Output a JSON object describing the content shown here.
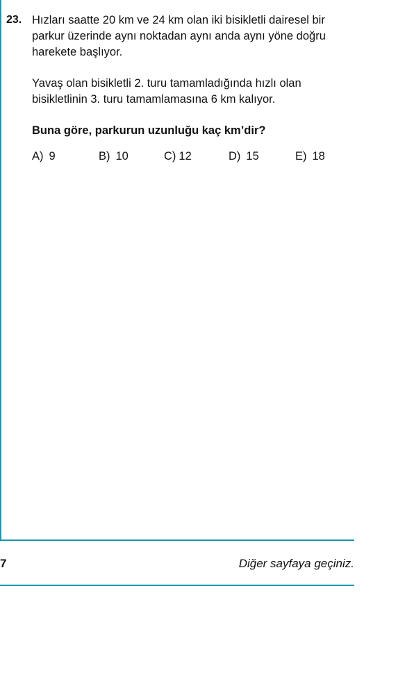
{
  "question": {
    "number": "23.",
    "paragraph1": "Hızları saatte 20 km ve 24 km olan iki bisikletli dairesel bir parkur üzerinde aynı noktadan aynı anda aynı yöne doğru harekete başlıyor.",
    "paragraph2": "Yavaş olan bisikletli 2. turu tamamladığında hızlı olan bisikletlinin 3. turu tamamlamasına 6 km kalıyor.",
    "prompt": "Buna göre, parkurun uzunluğu kaç km’dir?",
    "options": [
      {
        "letter": "A)",
        "value": "9"
      },
      {
        "letter": "B)",
        "value": "10"
      },
      {
        "letter": "C)",
        "value": "12"
      },
      {
        "letter": "D)",
        "value": "15"
      },
      {
        "letter": "E)",
        "value": "18"
      }
    ]
  },
  "footer": {
    "page_number": "7",
    "next_page_note": "Diğer sayfaya geçiniz."
  },
  "colors": {
    "accent_rule": "#0e9bb0",
    "text": "#111111"
  }
}
